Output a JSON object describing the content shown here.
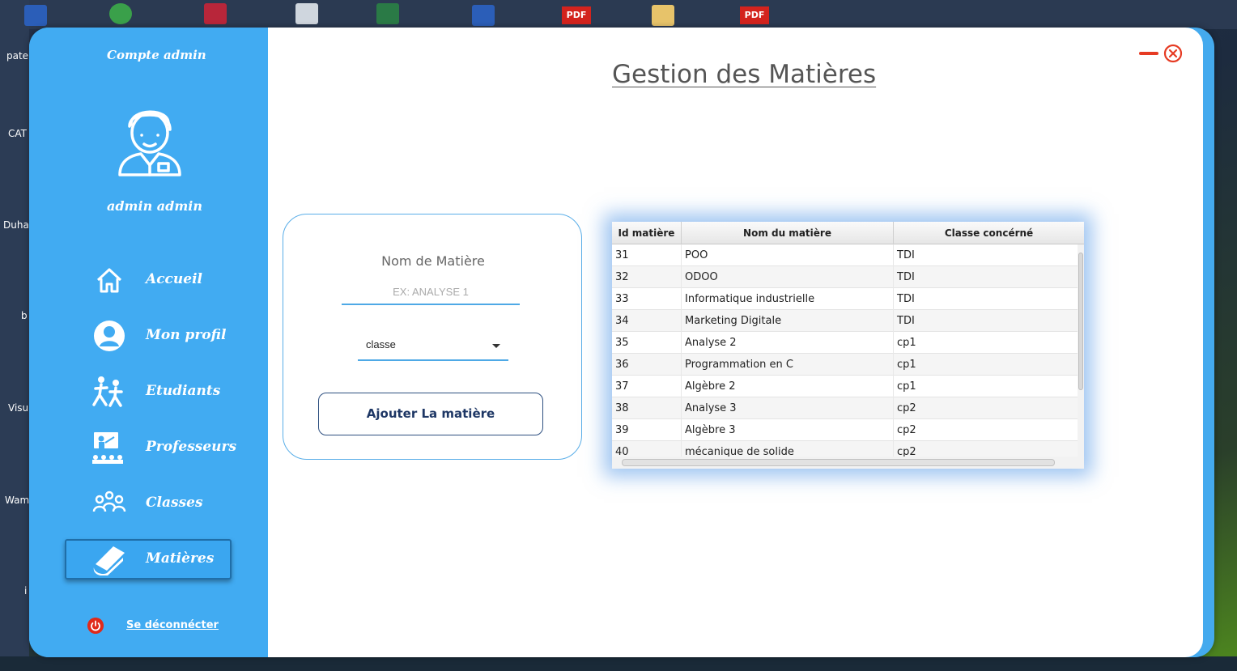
{
  "desktop": {
    "side_labels": [
      "pate",
      "CAT",
      "Duha",
      "b",
      "Visu",
      "Wam",
      "i"
    ],
    "pdf_badges": [
      "PDF",
      "PDF"
    ],
    "word_badges": [
      "W",
      "W"
    ]
  },
  "sidebar": {
    "account_title": "Compte admin",
    "avatar_icon": "user-avatar-icon",
    "user_name": "admin  admin",
    "items": [
      {
        "label": "Accueil",
        "icon": "home-icon"
      },
      {
        "label": "Mon profil",
        "icon": "profile-icon"
      },
      {
        "label": "Etudiants",
        "icon": "students-icon"
      },
      {
        "label": "Professeurs",
        "icon": "teacher-icon"
      },
      {
        "label": "Classes",
        "icon": "classes-icon"
      },
      {
        "label": "Matières",
        "icon": "book-icon",
        "active": true
      }
    ],
    "logout_label": "Se déconnécter",
    "logout_icon": "power-icon"
  },
  "main": {
    "title": "Gestion des Matières",
    "window_controls": {
      "minimize": "minimize-icon",
      "close": "close-icon"
    },
    "form": {
      "name_label": "Nom de Matière",
      "name_placeholder": "EX: ANALYSE 1",
      "name_value": "",
      "class_select_value": "classe",
      "add_button_label": "Ajouter La matière"
    },
    "table": {
      "columns": [
        "Id  matière",
        "Nom du matière",
        "Classe concérné"
      ],
      "rows": [
        [
          "31",
          "POO",
          "TDI"
        ],
        [
          "32",
          "ODOO",
          "TDI"
        ],
        [
          "33",
          "Informatique industrielle",
          "TDI"
        ],
        [
          "34",
          "Marketing Digitale",
          "TDI"
        ],
        [
          "35",
          "Analyse 2",
          "cp1"
        ],
        [
          "36",
          "Programmation en C",
          "cp1"
        ],
        [
          "37",
          "Algèbre 2",
          "cp1"
        ],
        [
          "38",
          "Analyse 3",
          "cp2"
        ],
        [
          "39",
          "Algèbre 3",
          "cp2"
        ],
        [
          "40",
          "mécanique de solide",
          "cp2"
        ]
      ]
    }
  },
  "colors": {
    "sidebar": "#41abf2",
    "accent": "#4ea9e6",
    "button_text": "#1e3765",
    "close": "#e63b23",
    "logout": "#e02a1a"
  }
}
